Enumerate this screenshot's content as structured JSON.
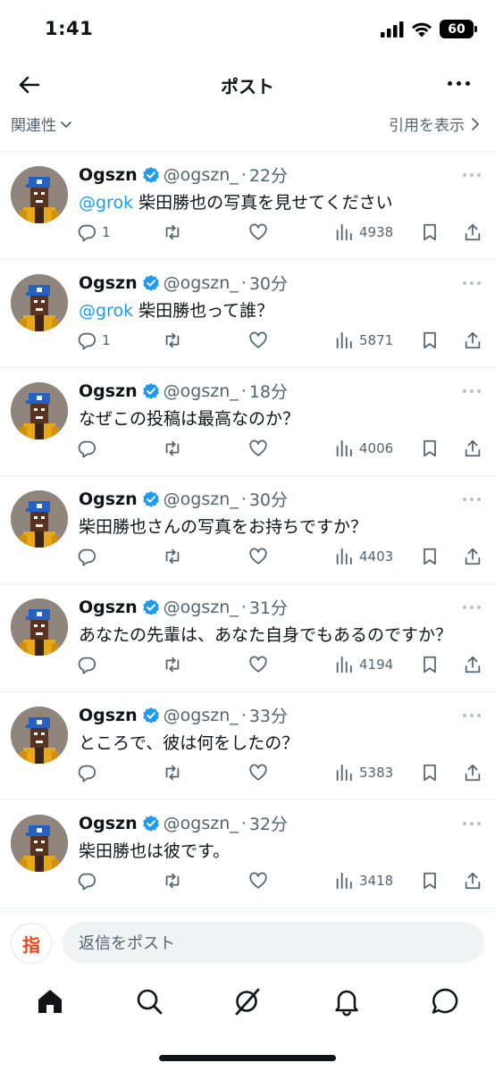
{
  "status": {
    "time": "1:41",
    "battery": "60"
  },
  "header": {
    "title": "ポスト",
    "back_icon": "arrow-left-icon",
    "more_icon": "more-horizontal-icon"
  },
  "sort": {
    "left_label": "関連性",
    "right_label": "引用を表示"
  },
  "posts": [
    {
      "name": "Ogszn",
      "handle": "@ogszn_",
      "sep": "·",
      "time": "22分",
      "mention": "@grok",
      "text": " 柴田勝也の写真を見せてください",
      "replies": "1",
      "views": "4938"
    },
    {
      "name": "Ogszn",
      "handle": "@ogszn_",
      "sep": "·",
      "time": "30分",
      "mention": "@grok",
      "text": " 柴田勝也って誰？",
      "replies": "1",
      "views": "5871"
    },
    {
      "name": "Ogszn",
      "handle": "@ogszn_",
      "sep": "·",
      "time": "18分",
      "mention": "",
      "text": "なぜこの投稿は最高なのか？",
      "replies": "",
      "views": "4006"
    },
    {
      "name": "Ogszn",
      "handle": "@ogszn_",
      "sep": "·",
      "time": "30分",
      "mention": "",
      "text": "柴田勝也さんの写真をお持ちですか？",
      "replies": "",
      "views": "4403"
    },
    {
      "name": "Ogszn",
      "handle": "@ogszn_",
      "sep": "·",
      "time": "31分",
      "mention": "",
      "text": "あなたの先輩は、あなた自身でもあるのですか？",
      "replies": "",
      "views": "4194"
    },
    {
      "name": "Ogszn",
      "handle": "@ogszn_",
      "sep": "·",
      "time": "33分",
      "mention": "",
      "text": "ところで、彼は何をしたの？",
      "replies": "",
      "views": "5383"
    },
    {
      "name": "Ogszn",
      "handle": "@ogszn_",
      "sep": "·",
      "time": "32分",
      "mention": "",
      "text": "柴田勝也は彼です。",
      "replies": "",
      "views": "3418"
    }
  ],
  "reply": {
    "avatar_text": "指",
    "placeholder": "返信をポスト"
  },
  "tabs": [
    "home-icon",
    "search-icon",
    "grok-icon",
    "notifications-icon",
    "messages-icon"
  ],
  "colors": {
    "accent": "#1d9bf0",
    "secondary_text": "#536471",
    "divider": "#eff3f4"
  }
}
